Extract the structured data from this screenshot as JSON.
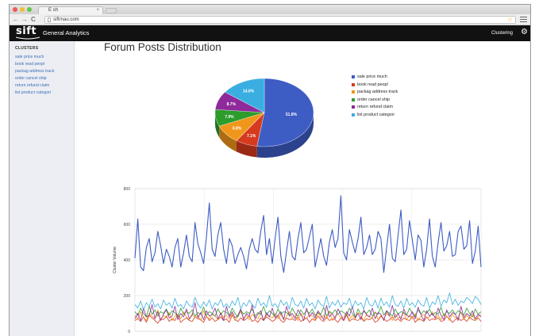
{
  "browser": {
    "tab_title": "E sh",
    "tab_close": "×",
    "nav_back": "←",
    "nav_forward": "→",
    "nav_reload": "C",
    "url": "siftrnau.com",
    "star": "☆"
  },
  "header": {
    "logo": "sift",
    "app_name": "General Analytics",
    "nav_clustering": "Clustering",
    "gear": "⚙"
  },
  "sidebar": {
    "heading": "CLUSTERS",
    "items": [
      {
        "label": "sale price much"
      },
      {
        "label": "book read peopl"
      },
      {
        "label": "packag address track"
      },
      {
        "label": "order cancel ship"
      },
      {
        "label": "return refund claim"
      },
      {
        "label": "list product categori"
      }
    ]
  },
  "main": {
    "title": "Forum Posts Distribution"
  },
  "colors": {
    "series": [
      "#3d5cc4",
      "#d63a1e",
      "#f0961a",
      "#2c9c2c",
      "#8e2a9a",
      "#3aaee0"
    ]
  },
  "chart_data": [
    {
      "type": "pie",
      "categories": [
        "sale price much",
        "book read peopl",
        "packag address track",
        "order cancel ship",
        "return refund claim",
        "list product categori"
      ],
      "values": [
        51.8,
        7.1,
        8.8,
        7.9,
        8.7,
        14.6
      ],
      "labels": [
        "51.8%",
        "7.1%",
        "8.8%",
        "7.9%",
        "8.7%",
        "14.6%"
      ],
      "legend_position": "right"
    },
    {
      "type": "line",
      "ylabel": "Cluster Volume",
      "ylim": [
        0,
        800
      ],
      "yticks": [
        0,
        200,
        400,
        600,
        800
      ],
      "grid": true,
      "series": [
        {
          "name": "sale price much",
          "values": [
            410,
            630,
            360,
            340,
            470,
            520,
            390,
            440,
            560,
            480,
            380,
            460,
            420,
            360,
            470,
            520,
            360,
            440,
            540,
            420,
            390,
            610,
            490,
            440,
            380,
            530,
            720,
            460,
            420,
            540,
            610,
            460,
            380,
            520,
            480,
            380,
            430,
            470,
            420,
            350,
            460,
            520,
            460,
            440,
            560,
            650,
            430,
            520,
            380,
            520,
            640,
            420,
            330,
            450,
            560,
            420,
            400,
            520,
            610,
            440,
            460,
            530,
            600,
            360,
            440,
            520,
            420,
            370,
            500,
            570,
            470,
            520,
            760,
            440,
            400,
            570,
            500,
            440,
            520,
            640,
            430,
            470,
            540,
            430,
            460,
            560,
            520,
            330,
            470,
            600,
            410,
            390,
            540,
            680,
            430,
            460,
            620,
            510,
            400,
            540,
            510,
            360,
            460,
            630,
            420,
            360,
            500,
            610,
            450,
            480,
            560,
            420,
            430,
            560,
            590,
            460,
            480,
            620,
            380,
            450,
            590,
            360
          ]
        },
        {
          "name": "book read peopl",
          "values": [
            60,
            70,
            55,
            80,
            50,
            90,
            75,
            60,
            45,
            70,
            65,
            85,
            55,
            70,
            60,
            95,
            50,
            65,
            75,
            60,
            55,
            80,
            70,
            65,
            50,
            85,
            60,
            75,
            55,
            65,
            80,
            60,
            70,
            50,
            90,
            65,
            55,
            75,
            60,
            70,
            85,
            55,
            65,
            50,
            75,
            60,
            80,
            70,
            55,
            65,
            90,
            60,
            50,
            75,
            65,
            70,
            60,
            80,
            55,
            65,
            75,
            50,
            70,
            60,
            85,
            65,
            55,
            80,
            60,
            70,
            65,
            50,
            75,
            60,
            90,
            55,
            70,
            65,
            60,
            80,
            55,
            70,
            65,
            75,
            50,
            60,
            85,
            70,
            55,
            65,
            80,
            60,
            70,
            55,
            75,
            65,
            60,
            85,
            50,
            70,
            65,
            55,
            80,
            60,
            70,
            65,
            75,
            55,
            60,
            85,
            70,
            50,
            65,
            75,
            60,
            70,
            55,
            80,
            65,
            60,
            75,
            55
          ]
        },
        {
          "name": "packag address track",
          "values": [
            90,
            70,
            110,
            80,
            60,
            100,
            85,
            70,
            120,
            65,
            90,
            75,
            105,
            60,
            85,
            95,
            70,
            110,
            80,
            65,
            100,
            75,
            90,
            60,
            115,
            80,
            70,
            95,
            85,
            65,
            105,
            75,
            90,
            70,
            100,
            60,
            85,
            110,
            75,
            90,
            65,
            95,
            80,
            70,
            105,
            60,
            90,
            85,
            75,
            100,
            70,
            95,
            65,
            85,
            110,
            75,
            90,
            60,
            100,
            80,
            70,
            95,
            85,
            65,
            105,
            75,
            90,
            70,
            115,
            60,
            85,
            95,
            75,
            80,
            100,
            65,
            90,
            70,
            105,
            85,
            60,
            95,
            80,
            75,
            110,
            65,
            90,
            70,
            100,
            85,
            60,
            95,
            75,
            80,
            105,
            65,
            90,
            70,
            100,
            60,
            85,
            95,
            75,
            80,
            110,
            70,
            90,
            65,
            100,
            85,
            60,
            95,
            75,
            80,
            105,
            65,
            90,
            70,
            100,
            60,
            85,
            95
          ]
        },
        {
          "name": "order cancel ship",
          "values": [
            110,
            90,
            130,
            100,
            80,
            140,
            95,
            120,
            85,
            110,
            100,
            125,
            90,
            115,
            105,
            80,
            130,
            95,
            110,
            100,
            120,
            85,
            105,
            95,
            135,
            90,
            110,
            100,
            85,
            125,
            95,
            115,
            105,
            90,
            130,
            100,
            80,
            120,
            95,
            110,
            100,
            125,
            85,
            105,
            95,
            140,
            90,
            115,
            100,
            85,
            125,
            95,
            110,
            105,
            90,
            130,
            100,
            85,
            120,
            95,
            115,
            100,
            125,
            90,
            105,
            95,
            135,
            85,
            110,
            100,
            120,
            95,
            115,
            105,
            90,
            130,
            100,
            80,
            125,
            95,
            110,
            100,
            120,
            85,
            105,
            95,
            140,
            90,
            115,
            100,
            85,
            125,
            95,
            110,
            105,
            90,
            130,
            100,
            85,
            120,
            95,
            115,
            100,
            125,
            90,
            105,
            95,
            135,
            85,
            110,
            100,
            120,
            95,
            115,
            105,
            90,
            130,
            100,
            80,
            125,
            95,
            110
          ]
        },
        {
          "name": "return refund claim",
          "values": [
            70,
            100,
            60,
            130,
            80,
            90,
            150,
            70,
            110,
            60,
            95,
            120,
            75,
            85,
            140,
            65,
            100,
            80,
            125,
            70,
            90,
            160,
            75,
            105,
            65,
            115,
            85,
            95,
            130,
            70,
            100,
            60,
            140,
            80,
            110,
            75,
            90,
            125,
            65,
            100,
            85,
            150,
            70,
            95,
            115,
            60,
            105,
            80,
            130,
            75,
            90,
            110,
            65,
            140,
            85,
            100,
            70,
            120,
            95,
            60,
            130,
            80,
            105,
            75,
            115,
            90,
            65,
            145,
            80,
            100,
            70,
            125,
            95,
            60,
            110,
            85,
            140,
            75,
            100,
            65,
            120,
            90,
            80,
            130,
            70,
            105,
            95,
            60,
            115,
            85,
            145,
            75,
            100,
            65,
            125,
            90,
            80,
            110,
            70,
            135,
            95,
            60,
            115,
            85,
            100,
            75,
            130,
            90,
            65,
            120,
            80,
            105,
            95,
            60,
            140,
            75,
            100,
            85,
            115,
            70,
            95,
            80
          ]
        },
        {
          "name": "list product categori",
          "values": [
            150,
            130,
            170,
            120,
            160,
            140,
            180,
            135,
            155,
            125,
            175,
            145,
            160,
            130,
            185,
            140,
            150,
            125,
            170,
            145,
            135,
            190,
            150,
            130,
            165,
            140,
            175,
            125,
            160,
            145,
            180,
            135,
            155,
            130,
            170,
            145,
            190,
            125,
            160,
            140,
            175,
            150,
            130,
            185,
            145,
            160,
            135,
            200,
            140,
            155,
            130,
            175,
            145,
            165,
            125,
            190,
            150,
            140,
            170,
            130,
            185,
            145,
            160,
            125,
            175,
            150,
            140,
            195,
            130,
            165,
            145,
            175,
            135,
            160,
            150,
            185,
            130,
            170,
            145,
            160,
            125,
            190,
            150,
            140,
            175,
            130,
            185,
            145,
            165,
            135,
            200,
            150,
            140,
            170,
            130,
            185,
            145,
            160,
            135,
            175,
            150,
            140,
            190,
            130,
            165,
            150,
            200,
            140,
            175,
            160,
            215,
            150,
            180,
            145,
            170,
            160,
            190,
            175,
            155,
            195,
            180,
            150
          ]
        }
      ]
    }
  ]
}
